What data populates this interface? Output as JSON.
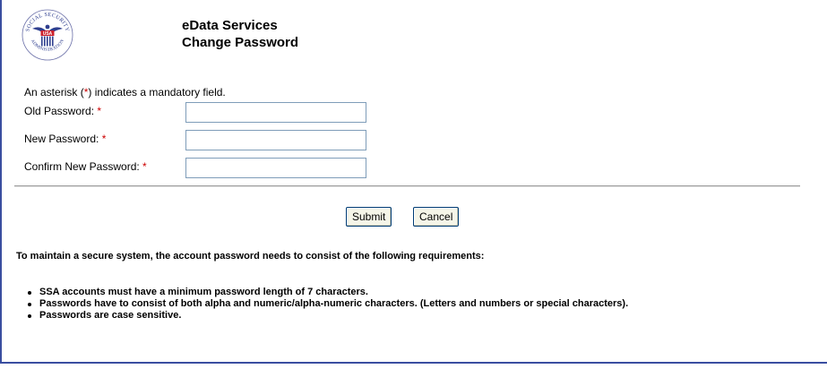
{
  "header": {
    "logo_text_top": "SOCIAL SECURITY",
    "logo_text_bottom": "ADMINISTRATION",
    "logo_shield_text": "USA",
    "title_line1": "eData Services",
    "title_line2": "Change Password"
  },
  "form": {
    "note_before": "An asterisk (",
    "note_asterisk": "*",
    "note_after": ") indicates a mandatory field.",
    "old_password_label": "Old Password:",
    "new_password_label": "New Password:",
    "confirm_password_label": "Confirm New Password:",
    "required_mark": "*",
    "old_password_value": "",
    "new_password_value": "",
    "confirm_password_value": ""
  },
  "buttons": {
    "submit_label": "Submit",
    "cancel_label": "Cancel"
  },
  "info": {
    "intro": "To maintain a secure system, the account password needs to consist of the following requirements:",
    "requirements": [
      "SSA accounts must have a minimum password length of 7 characters.",
      "Passwords have to consist of both alpha and numeric/alpha-numeric characters. (Letters and numbers or special characters).",
      "Passwords are case sensitive."
    ]
  },
  "colors": {
    "required": "#cc0000",
    "frame_border": "#3a4ea0"
  }
}
